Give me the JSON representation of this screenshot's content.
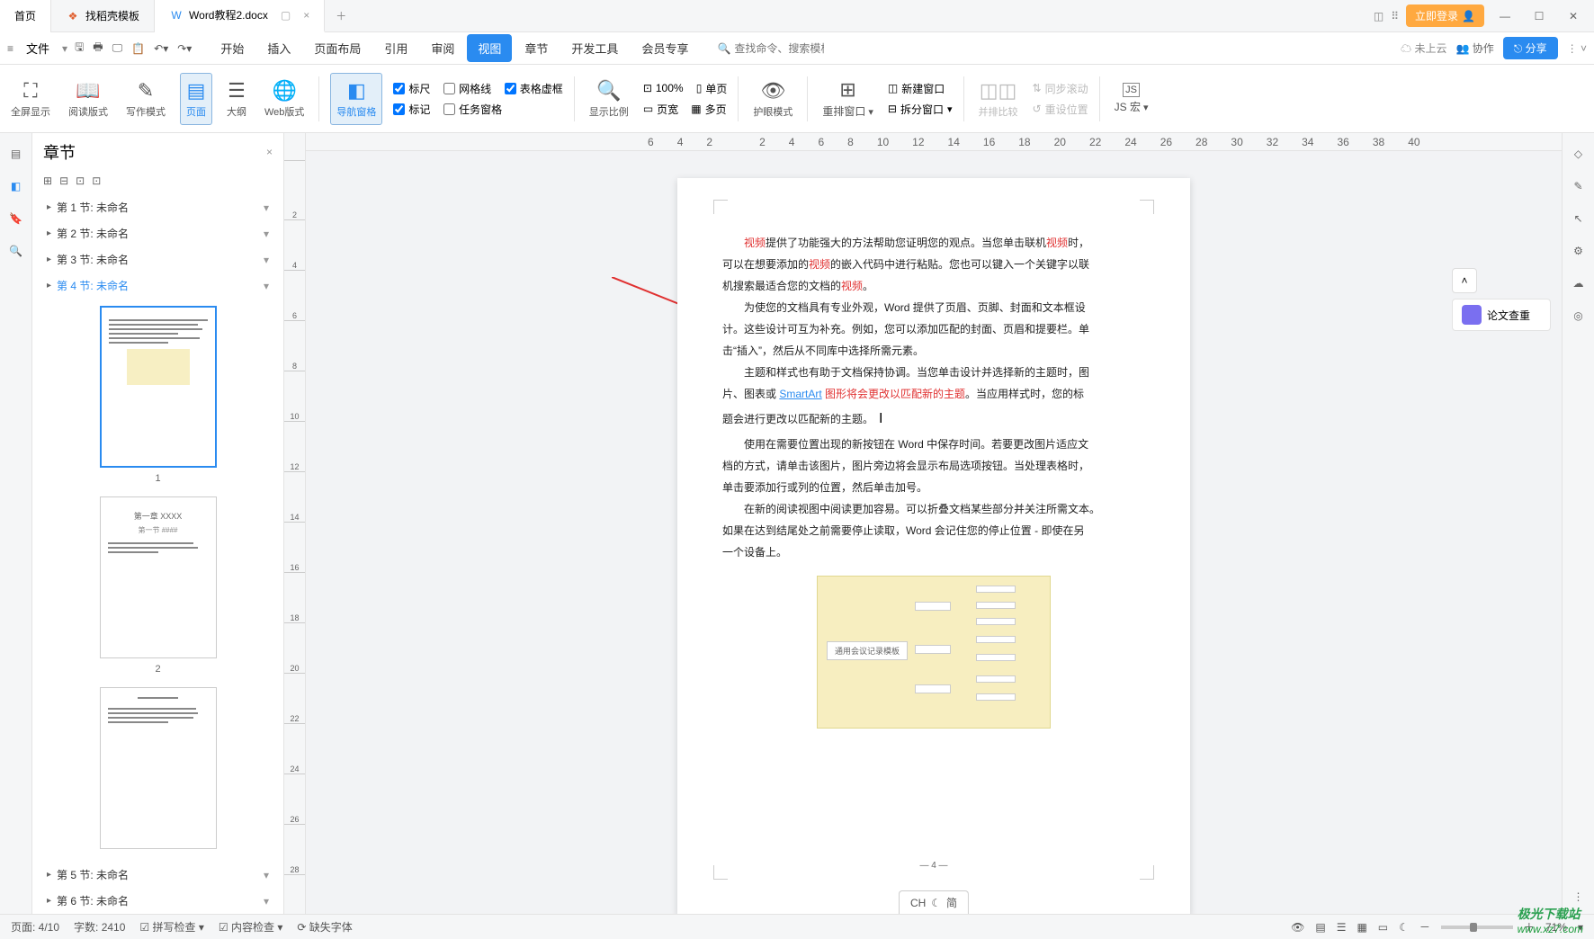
{
  "titlebar": {
    "home": "首页",
    "tab1": "找稻壳模板",
    "tab2": "Word教程2.docx",
    "login": "立即登录"
  },
  "menubar": {
    "file": "文件",
    "tabs": [
      "开始",
      "插入",
      "页面布局",
      "引用",
      "审阅",
      "视图",
      "章节",
      "开发工具",
      "会员专享"
    ],
    "active_index": 5,
    "search_placeholder": "查找命令、搜索模板",
    "cloud": "未上云",
    "coop": "协作",
    "share": "分享"
  },
  "ribbon": {
    "g1": "全屏显示",
    "g2": "阅读版式",
    "g3": "写作模式",
    "g4": "页面",
    "g5": "大纲",
    "g6": "Web版式",
    "g7": "导航窗格",
    "chk_ruler": "标尺",
    "chk_grid": "网格线",
    "chk_mark": "标记",
    "chk_task": "任务窗格",
    "chk_table": "表格虚框",
    "g8": "显示比例",
    "g9_pct": "100%",
    "g9": "单页",
    "g10": "页宽",
    "g11": "多页",
    "g12": "护眼模式",
    "g13": "重排窗口",
    "g14": "拆分窗口",
    "g15": "新建窗口",
    "g16": "并排比较",
    "g17": "同步滚动",
    "g18": "重设位置",
    "g19": "JS 宏"
  },
  "nav": {
    "title": "章节",
    "items": [
      {
        "label": "第 1 节: 未命名"
      },
      {
        "label": "第 2 节: 未命名"
      },
      {
        "label": "第 3 节: 未命名"
      },
      {
        "label": "第 4 节: 未命名",
        "selected": true
      },
      {
        "label": "第 5 节: 未命名"
      },
      {
        "label": "第 6 节: 未命名"
      }
    ],
    "thumb1_num": "1",
    "thumb2_num": "2"
  },
  "ruler_h": [
    "6",
    "4",
    "2",
    "",
    "2",
    "4",
    "6",
    "8",
    "10",
    "12",
    "14",
    "16",
    "18",
    "20",
    "22",
    "24",
    "26",
    "28",
    "30",
    "32",
    "34",
    "36",
    "38",
    "40"
  ],
  "ruler_v": [
    "",
    "2",
    "4",
    "6",
    "8",
    "10",
    "12",
    "14",
    "16",
    "18",
    "20",
    "22",
    "24",
    "26",
    "28"
  ],
  "doc": {
    "p1a": "视频",
    "p1b": "提供了功能强大的方法帮助您证明您的观点。当您单击联机",
    "p1c": "视频",
    "p1d": "时，",
    "p2a": "可以在想要添加的",
    "p2b": "视频",
    "p2c": "的嵌入代码中进行粘贴。您也可以键入一个关键字以联",
    "p3a": "机搜索最适合您的文档的",
    "p3b": "视频",
    "p3c": "。",
    "p4": "为使您的文档具有专业外观，Word 提供了页眉、页脚、封面和文本框设",
    "p5": "计。这些设计可互为补充。例如，您可以添加匹配的封面、页眉和提要栏。单",
    "p6": "击“插入”，然后从不同库中选择所需元素。",
    "p7": "主题和样式也有助于文档保持协调。当您单击设计并选择新的主题时，图",
    "p8a": "片、图表或 ",
    "p8b": "SmartArt",
    "p8c": " 图形将会更改以匹配新的主题",
    "p8d": "。当应用样式时，您的标",
    "p9": "题会进行更改以匹配新的主题。",
    "p10": "使用在需要位置出现的新按钮在 Word 中保存时间。若要更改图片适应文",
    "p11": "档的方式，请单击该图片，图片旁边将会显示布局选项按钮。当处理表格时，",
    "p12": "单击要添加行或列的位置，然后单击加号。",
    "p13": "在新的阅读视图中阅读更加容易。可以折叠文档某些部分并关注所需文本。",
    "p14": "如果在达到结尾处之前需要停止读取，Word 会记住您的停止位置 - 即使在另",
    "p15": "一个设备上。",
    "page_num": "— 4 —",
    "mm_center": "通用会议记录模板"
  },
  "float": {
    "chk_label": "论文查重"
  },
  "ime": {
    "ch": "CH",
    "jian": "简"
  },
  "status": {
    "page": "页面: 4/10",
    "words": "字数: 2410",
    "spell": "拼写检查",
    "content": "内容检查",
    "font": "缺失字体",
    "zoom": "71%"
  },
  "watermark": {
    "brand": "极光下载站",
    "url": "www.xz7.com"
  }
}
